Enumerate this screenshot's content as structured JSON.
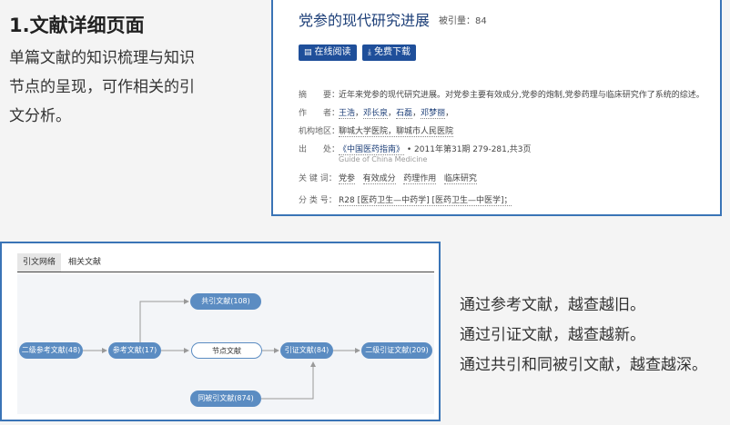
{
  "left": {
    "title": "1.文献详细页面",
    "desc_lines": [
      "单篇文献的知识梳理与知识",
      "节点的呈现，可作相关的引",
      "文分析。"
    ]
  },
  "paper": {
    "title": "党参的现代研究进展",
    "cited": "被引量：84",
    "read_button": "在线阅读",
    "download_button": "免费下载",
    "abstract_key": "摘　　要：",
    "abstract_value": "近年来党参的现代研究进展。对党参主要有效成分,党参的炮制,党参药理与临床研究作了系统的综述。",
    "authors_key": "作　　者：",
    "authors": [
      "王浩",
      "邓长泉",
      "石磊",
      "邓梦丽"
    ],
    "org_key": "机构地区：",
    "org_value": "聊城大学医院，聊城市人民医院",
    "source_key": "出　　处：",
    "source_journal": "《中国医药指南》",
    "source_detail": "• 2011年第31期 279-281,共3页",
    "source_en": "Guide of China Medicine",
    "keywords_key": "关 键 词：",
    "keywords": [
      "党参",
      "有效成分",
      "药理作用",
      "临床研究"
    ],
    "class_key": "分 类 号：",
    "class_value": "R28 [医药卫生—中药学] [医药卫生—中医学]；"
  },
  "network": {
    "tab_active": "引文网络",
    "tab_other": "相关文献",
    "nodes": {
      "level2_ref": "二级参考文献(48)",
      "ref": "参考文献(17)",
      "center": "节点文献",
      "citing": "引证文献(84)",
      "level2_citing": "二级引证文献(209)",
      "co_cited": "共引文献(108)",
      "co_citing": "同被引文献(874)"
    }
  },
  "tagline": [
    "通过参考文献，越查越旧。",
    "通过引证文献，越查越新。",
    "通过共引和同被引文献，越查越深。"
  ],
  "colors": {
    "accent": "#3a74b6",
    "button": "#1f4f9a",
    "node": "#5b8cc2"
  }
}
